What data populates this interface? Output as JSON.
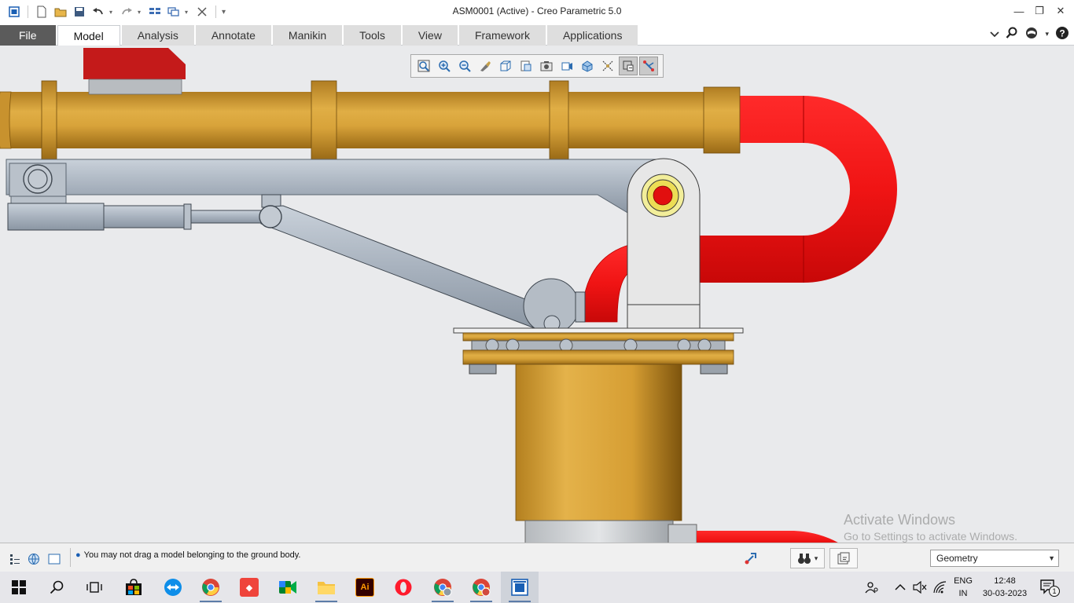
{
  "window": {
    "title": "ASM0001 (Active) - Creo Parametric 5.0",
    "controls": {
      "minimize": "—",
      "restore": "❐",
      "close": "✕"
    }
  },
  "quick_access": {
    "icons": [
      "window-icon",
      "new-icon",
      "open-icon",
      "save-icon",
      "undo-icon",
      "redo-icon",
      "regenerate-icon",
      "windows-icon",
      "close-window-icon",
      "customize-icon"
    ]
  },
  "ribbon": {
    "tabs": [
      {
        "label": "File"
      },
      {
        "label": "Model"
      },
      {
        "label": "Analysis"
      },
      {
        "label": "Annotate"
      },
      {
        "label": "Manikin"
      },
      {
        "label": "Tools"
      },
      {
        "label": "View"
      },
      {
        "label": "Framework"
      },
      {
        "label": "Applications"
      }
    ],
    "active_tab": "Model"
  },
  "graphics_toolbar": {
    "buttons": [
      "refit-icon",
      "zoom-in-icon",
      "zoom-out-icon",
      "repaint-icon",
      "display-style-icon",
      "saved-orientations-icon",
      "view-manager-icon",
      "perspective-icon",
      "section-icon",
      "datum-display-icon",
      "spin-center-icon",
      "annotation-display-icon"
    ]
  },
  "status": {
    "message": "You may not drag a model belonging to the ground body.",
    "filter": "Geometry"
  },
  "watermark": {
    "title": "Activate Windows",
    "subtitle": "Go to Settings to activate Windows."
  },
  "taskbar": {
    "language_line1": "ENG",
    "language_line2": "IN",
    "time": "12:48",
    "date": "30-03-2023",
    "notification_count": "1",
    "apps": [
      {
        "name": "store",
        "label": ""
      },
      {
        "name": "teamviewer",
        "label": ""
      },
      {
        "name": "chrome",
        "label": ""
      },
      {
        "name": "anydesk",
        "label": ""
      },
      {
        "name": "meet",
        "label": ""
      },
      {
        "name": "file-explorer",
        "label": ""
      },
      {
        "name": "illustrator",
        "label": "Ai"
      },
      {
        "name": "opera",
        "label": "O"
      },
      {
        "name": "chrome-profile-2",
        "label": ""
      },
      {
        "name": "chrome-profile-3",
        "label": ""
      },
      {
        "name": "creo",
        "label": ""
      }
    ]
  },
  "colors": {
    "pipe_gold": "#d4a035",
    "pipe_red": "#f01818",
    "frame_gray": "#a9b4c2",
    "accent": "#1a5fb4"
  }
}
